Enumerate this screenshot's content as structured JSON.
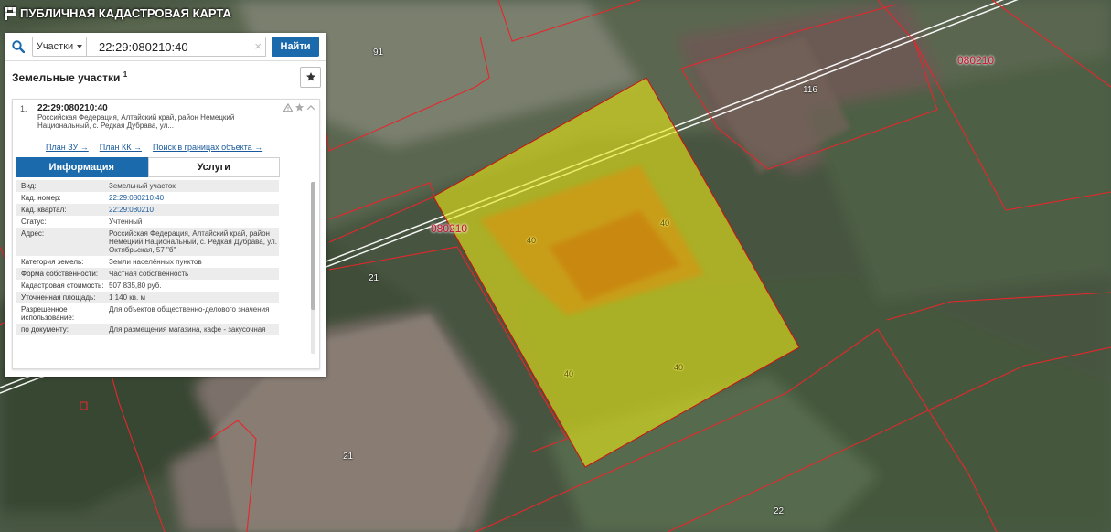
{
  "app": {
    "title": "ПУБЛИЧНАЯ КАДАСТРОВАЯ КАРТА"
  },
  "search": {
    "scope_label": "Участки",
    "value": "22:29:080210:40",
    "clear_label": "×",
    "find_label": "Найти"
  },
  "results": {
    "section_title": "Земельные участки",
    "count": "1",
    "item": {
      "index": "1.",
      "cadastral_number": "22:29:080210:40",
      "address_short": "Российская Федерация, Алтайский край, район Немецкий Национальный, с. Редкая Дубрава, ул...",
      "links": {
        "plan_zu": "План ЗУ →",
        "plan_kk": "План КК →",
        "search_within": "Поиск в границах объекта →"
      },
      "tabs": {
        "info": "Информация",
        "services": "Услуги"
      },
      "attributes": [
        {
          "key": "Вид:",
          "value": "Земельный участок",
          "link": false
        },
        {
          "key": "Кад. номер:",
          "value": "22:29:080210:40",
          "link": true
        },
        {
          "key": "Кад. квартал:",
          "value": "22:29:080210",
          "link": true
        },
        {
          "key": "Статус:",
          "value": "Учтенный",
          "link": false
        },
        {
          "key": "Адрес:",
          "value": "Российская Федерация, Алтайский край, район Немецкий Национальный, с. Редкая Дубрава, ул. Октябрьская, 57 \"б\"",
          "link": false
        },
        {
          "key": "Категория земель:",
          "value": "Земли населённых пунктов",
          "link": false
        },
        {
          "key": "Форма собственности:",
          "value": "Частная собственность",
          "link": false
        },
        {
          "key": "Кадастровая стоимость:",
          "value": "507 835,80 руб.",
          "link": false
        },
        {
          "key": "Уточненная площадь:",
          "value": "1 140 кв. м",
          "link": false
        },
        {
          "key": "Разрешенное использование:",
          "value": "Для объектов общественно-делового значения",
          "link": false
        },
        {
          "key": "по документу:",
          "value": "Для размещения магазина, кафе - закусочная",
          "link": false
        }
      ]
    }
  },
  "map": {
    "quarter_labels": [
      "080210",
      "080210"
    ],
    "parcel_numbers": [
      "91",
      "116",
      "21",
      "21",
      "22"
    ],
    "selected_parcel_labels": [
      "40",
      "40",
      "40",
      "40"
    ],
    "colors": {
      "boundary": "#e8262b",
      "selection_fill": "#e6e619",
      "selection_stroke": "#d01010",
      "accent": "#1a6aac"
    }
  }
}
